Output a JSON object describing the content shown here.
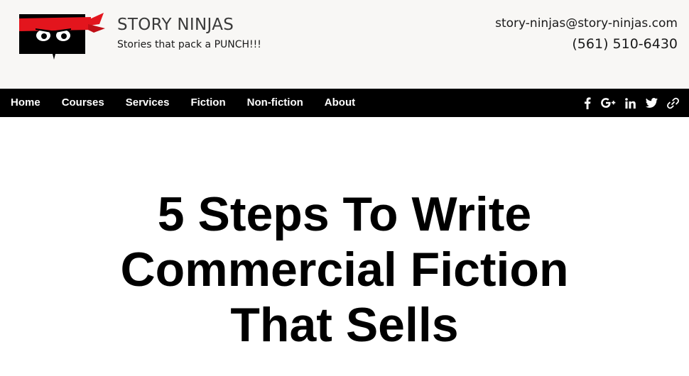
{
  "header": {
    "brand_name": "STORY NINJAS",
    "tagline": "Stories that pack a PUNCH!!!",
    "email": "story-ninjas@story-ninjas.com",
    "phone": "(561) 510-6430",
    "logo_icon": "ninja-book-logo-icon"
  },
  "nav": {
    "items": [
      {
        "label": "Home"
      },
      {
        "label": "Courses"
      },
      {
        "label": "Services"
      },
      {
        "label": "Fiction"
      },
      {
        "label": "Non-fiction"
      },
      {
        "label": "About"
      }
    ]
  },
  "social": [
    {
      "icon": "facebook-icon"
    },
    {
      "icon": "google-plus-icon"
    },
    {
      "icon": "linkedin-icon"
    },
    {
      "icon": "twitter-icon"
    },
    {
      "icon": "link-icon"
    }
  ],
  "article": {
    "title_line_1": "5 Steps To Write",
    "title_line_2": "Commercial Fiction",
    "title_line_3": "That Sells"
  },
  "colors": {
    "header_bg": "#f8f7f5",
    "nav_bg": "#000000",
    "accent_red": "#e3151d",
    "text": "#000000"
  }
}
